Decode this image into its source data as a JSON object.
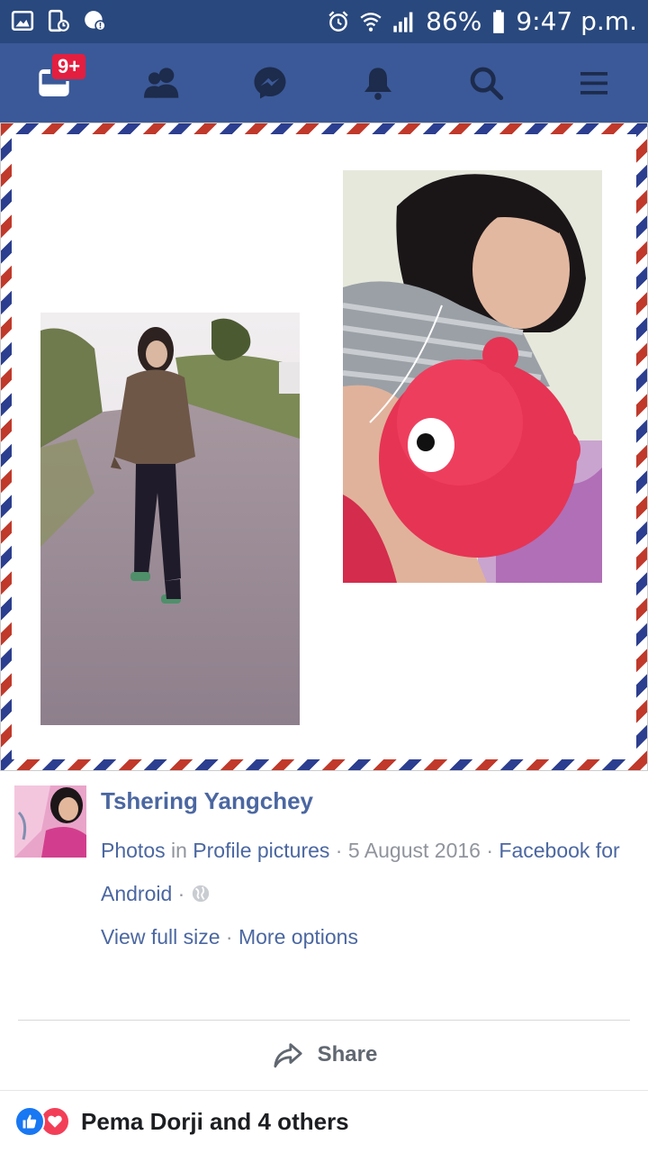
{
  "status_bar": {
    "battery": "86%",
    "time": "9:47 p.m."
  },
  "nav": {
    "notification_badge": "9+",
    "active_color": "#ffffff",
    "bar_color": "#3b5998",
    "icons": [
      "news-feed-icon",
      "friends-icon",
      "messenger-icon",
      "notifications-icon",
      "search-icon",
      "menu-icon"
    ]
  },
  "post": {
    "author": "Tshering Yangchey",
    "meta_album_prefix": "Photos",
    "meta_in": " in ",
    "meta_album": "Profile pictures",
    "meta_sep1": " · ",
    "meta_date": "5 August 2016",
    "meta_sep2": " · ",
    "meta_app": "Facebook for Android",
    "meta_sep3": " · ",
    "view_full_size": "View full size",
    "meta_sep4": " · ",
    "more_options": "More options"
  },
  "actions": {
    "share_label": "Share"
  },
  "reactions": {
    "summary": "Pema Dorji and 4 others"
  }
}
